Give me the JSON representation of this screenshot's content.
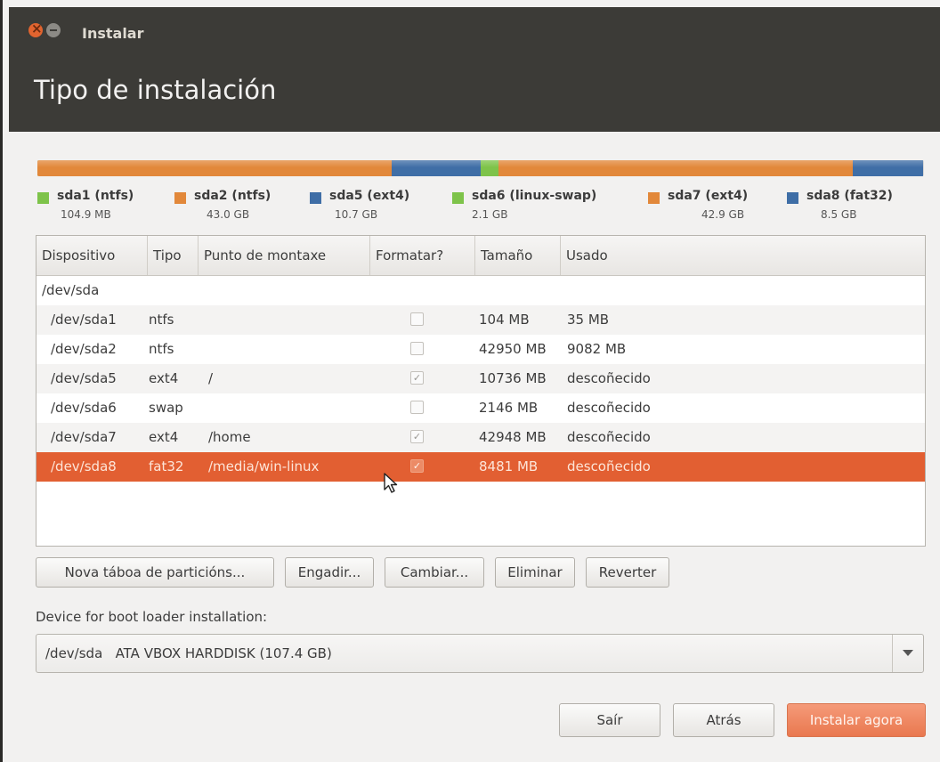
{
  "window": {
    "title": "Instalar",
    "page_title": "Tipo de instalación"
  },
  "partitions": [
    {
      "name": "sda1 (ntfs)",
      "size": "104.9 MB",
      "color": "#7ec34a",
      "fraction": 0.0001
    },
    {
      "name": "sda2 (ntfs)",
      "size": "43.0 GB",
      "color": "#e2883a",
      "fraction": 0.4
    },
    {
      "name": "sda5 (ext4)",
      "size": "10.7 GB",
      "color": "#3f6ea6",
      "fraction": 0.1
    },
    {
      "name": "sda6 (linux-swap)",
      "size": "2.1 GB",
      "color": "#7ec34a",
      "fraction": 0.02
    },
    {
      "name": "sda7 (ext4)",
      "size": "42.9 GB",
      "color": "#e2883a",
      "fraction": 0.4
    },
    {
      "name": "sda8 (fat32)",
      "size": "8.5 GB",
      "color": "#3f6ea6",
      "fraction": 0.0789
    }
  ],
  "table": {
    "columns": [
      "Dispositivo",
      "Tipo",
      "Punto de montaxe",
      "Formatar?",
      "Tamaño",
      "Usado"
    ],
    "disk": "/dev/sda",
    "rows": [
      {
        "device": "/dev/sda1",
        "type": "ntfs",
        "mount": "",
        "format": false,
        "size": "104 MB",
        "used": "35 MB"
      },
      {
        "device": "/dev/sda2",
        "type": "ntfs",
        "mount": "",
        "format": false,
        "size": "42950 MB",
        "used": "9082 MB"
      },
      {
        "device": "/dev/sda5",
        "type": "ext4",
        "mount": "/",
        "format": true,
        "size": "10736 MB",
        "used": "descoñecido"
      },
      {
        "device": "/dev/sda6",
        "type": "swap",
        "mount": "",
        "format": false,
        "size": "2146 MB",
        "used": "descoñecido"
      },
      {
        "device": "/dev/sda7",
        "type": "ext4",
        "mount": "/home",
        "format": true,
        "size": "42948 MB",
        "used": "descoñecido"
      },
      {
        "device": "/dev/sda8",
        "type": "fat32",
        "mount": "/media/win-linux",
        "format": true,
        "size": "8481 MB",
        "used": "descoñecido",
        "selected": true
      }
    ]
  },
  "actions": {
    "new_table": "Nova táboa de particións...",
    "add": "Engadir...",
    "change": "Cambiar...",
    "delete": "Eliminar",
    "revert": "Reverter"
  },
  "boot": {
    "label": "Device for boot loader installation:",
    "value": "/dev/sda   ATA VBOX HARDDISK (107.4 GB)"
  },
  "footer": {
    "quit": "Saír",
    "back": "Atrás",
    "install": "Instalar agora"
  },
  "icons": {
    "close": "close-icon",
    "minimize": "minimize-icon",
    "dropdown": "chevron-down-icon",
    "cursor": "mouse-pointer-icon"
  },
  "colors": {
    "accent": "#e25f32",
    "titlebar": "#3c3b37"
  }
}
